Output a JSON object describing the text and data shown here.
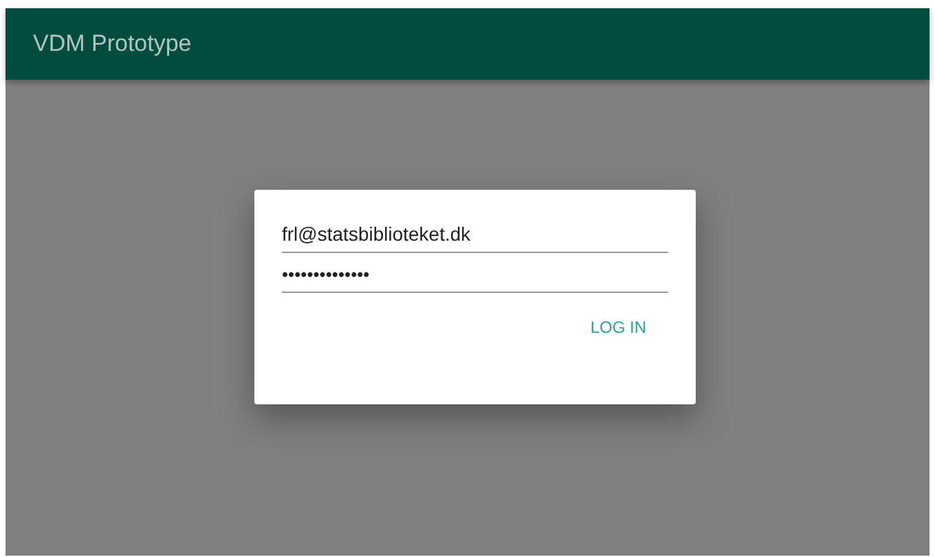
{
  "app_bar": {
    "title": "VDM Prototype"
  },
  "login_dialog": {
    "email": "frl@statsbiblioteket.dk",
    "password": "••••••••••••••",
    "button": "LOG IN"
  }
}
